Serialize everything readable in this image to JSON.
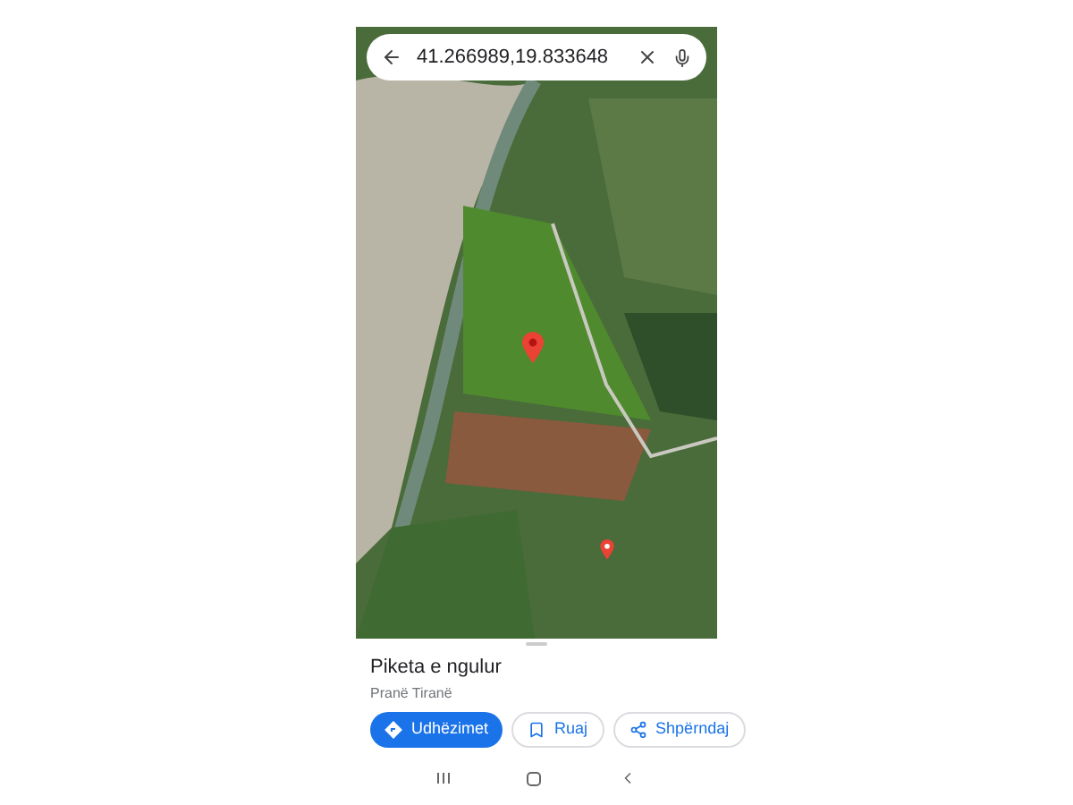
{
  "search": {
    "value": "41.266989,19.833648"
  },
  "place": {
    "title": "Piketa e ngulur",
    "subtitle": "Pranë Tiranë"
  },
  "actions": [
    {
      "kind": "primary",
      "label": "Udhëzimet"
    },
    {
      "kind": "save",
      "label": "Ruaj"
    },
    {
      "kind": "share",
      "label": "Shpërndaj"
    }
  ]
}
